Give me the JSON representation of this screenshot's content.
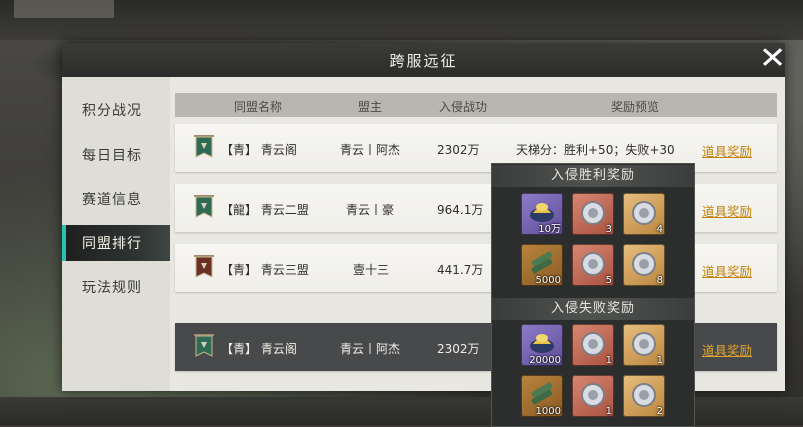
{
  "window": {
    "title": "跨服远征",
    "close_symbol": "✕"
  },
  "sidebar": {
    "items": [
      {
        "label": "积分战况",
        "active": false
      },
      {
        "label": "每日目标",
        "active": false
      },
      {
        "label": "赛道信息",
        "active": false
      },
      {
        "label": "同盟排行",
        "active": true
      },
      {
        "label": "玩法规则",
        "active": false
      }
    ]
  },
  "table": {
    "headers": [
      "同盟名称",
      "盟主",
      "入侵战功",
      "奖励预览"
    ],
    "rows": [
      {
        "alliance": "【青】 青云阁",
        "leader": "青云丨阿杰",
        "merit": "2302万",
        "preview": "天梯分：胜利+50；失败+30",
        "reward": "道具奖励",
        "banner_color": "#2f6a55"
      },
      {
        "alliance": "【龍】 青云二盟",
        "leader": "青云丨豪",
        "merit": "964.1万",
        "preview": "",
        "reward": "道具奖励",
        "banner_color": "#2f6a55"
      },
      {
        "alliance": "【青】 青云三盟",
        "leader": "壹十三",
        "merit": "441.7万",
        "preview": "",
        "reward": "道具奖励",
        "banner_color": "#6b2f27"
      },
      {
        "alliance": "【青】 青云阁",
        "leader": "青云丨阿杰",
        "merit": "2302万",
        "preview": "",
        "reward": "道具奖励",
        "banner_color": "#2f6a55"
      }
    ]
  },
  "popup": {
    "win_title": "入侵胜利奖励",
    "lose_title": "入侵失败奖励",
    "win_items": [
      {
        "icon": "gold-ingot-icon",
        "color": "purple",
        "count": "10万",
        "tag": "",
        "badge": ""
      },
      {
        "icon": "silver-coin-icon",
        "color": "red",
        "count": "3",
        "tag": "",
        "badge": ""
      },
      {
        "icon": "silver-coin-icon",
        "color": "gold",
        "count": "4",
        "tag": "",
        "badge": ""
      },
      {
        "icon": "scroll-bundle-icon",
        "color": "olive",
        "count": "5000",
        "tag": "",
        "badge": ""
      },
      {
        "icon": "silver-coin-icon",
        "color": "red",
        "count": "5",
        "tag": "",
        "badge": ""
      },
      {
        "icon": "silver-coin-icon",
        "color": "gold",
        "count": "8",
        "tag": "",
        "badge": ""
      }
    ],
    "lose_items": [
      {
        "icon": "gold-ingot-icon",
        "color": "purple",
        "count": "20000",
        "tag": "",
        "badge": ""
      },
      {
        "icon": "silver-coin-icon",
        "color": "red",
        "count": "1",
        "tag": "",
        "badge": ""
      },
      {
        "icon": "silver-coin-icon",
        "color": "gold",
        "count": "1",
        "tag": "",
        "badge": ""
      },
      {
        "icon": "scroll-bundle-icon",
        "color": "olive",
        "count": "1000",
        "tag": "",
        "badge": ""
      },
      {
        "icon": "silver-coin-icon",
        "color": "red",
        "count": "1",
        "tag": "",
        "badge": ""
      },
      {
        "icon": "silver-coin-icon",
        "color": "gold",
        "count": "2",
        "tag": "",
        "badge": ""
      }
    ]
  },
  "colors": {
    "accent": "#c0820c",
    "active_bar": "#2bc0b0"
  }
}
